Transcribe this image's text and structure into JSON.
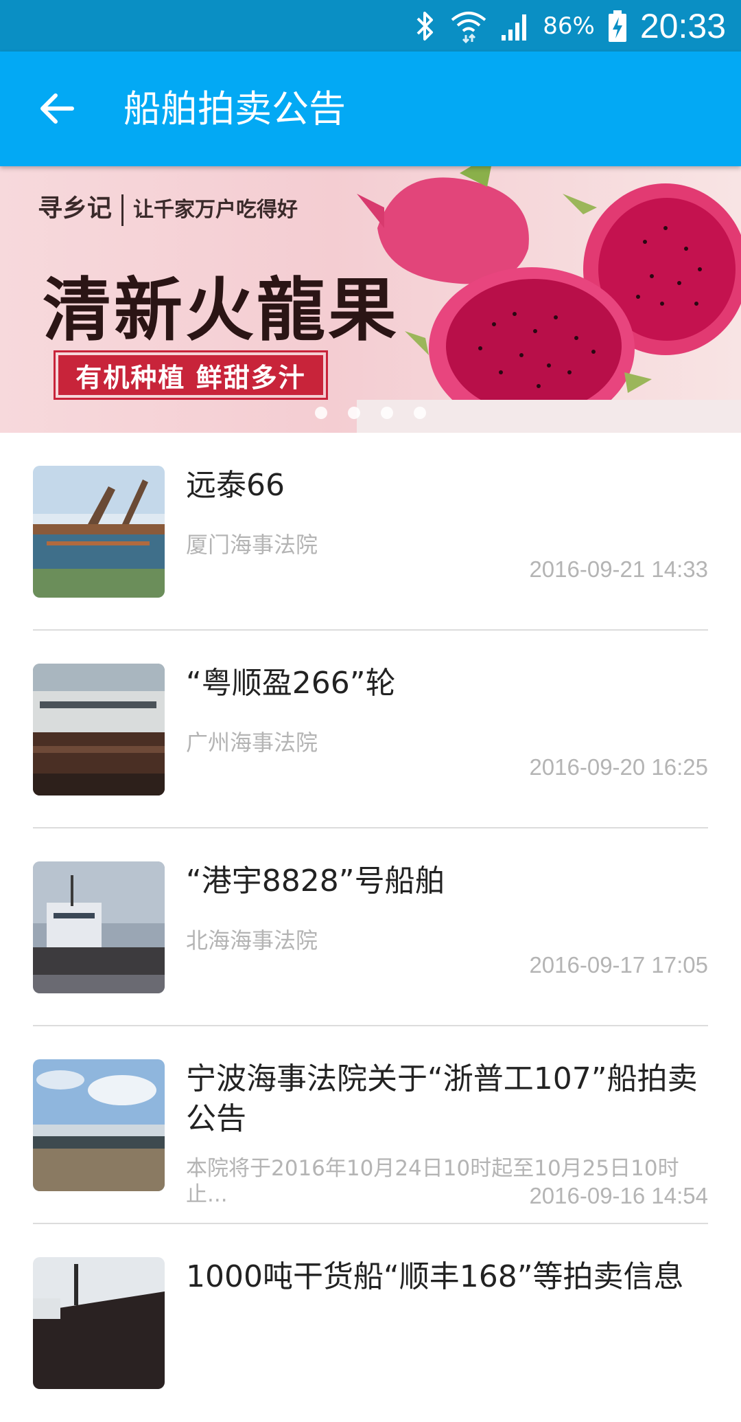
{
  "status_bar": {
    "battery_percent": "86%",
    "time": "20:33",
    "icons": [
      "bluetooth-icon",
      "wifi-icon",
      "signal-icon",
      "battery-charging-icon"
    ]
  },
  "app_bar": {
    "title": "船舶拍卖公告",
    "back_icon": "arrow-left-icon"
  },
  "banner": {
    "brand": "寻乡记",
    "slogan": "让千家万户吃得好",
    "headline": "清新火龍果",
    "tag": "有机种植  鲜甜多汁",
    "page_indicator": {
      "count": 4,
      "active_index": 3
    }
  },
  "listings": [
    {
      "title": "远泰66",
      "subtitle": "厦门海事法院",
      "date": "2016-09-21 14:33"
    },
    {
      "title": "“粤顺盈266”轮",
      "subtitle": "广州海事法院",
      "date": "2016-09-20 16:25"
    },
    {
      "title": "“港宇8828”号船舶",
      "subtitle": "北海海事法院",
      "date": "2016-09-17 17:05"
    },
    {
      "title": "宁波海事法院关于“浙普工107”船拍卖公告",
      "subtitle": "本院将于2016年10月24日10时起至10月25日10时止...",
      "date": "2016-09-16 14:54"
    },
    {
      "title": "1000吨干货船“顺丰168”等拍卖信息"
    }
  ],
  "colors": {
    "status_bar": "#0a8fc4",
    "app_bar": "#03a9f4",
    "secondary_text": "#b4b4b4",
    "primary_text": "#222222"
  }
}
